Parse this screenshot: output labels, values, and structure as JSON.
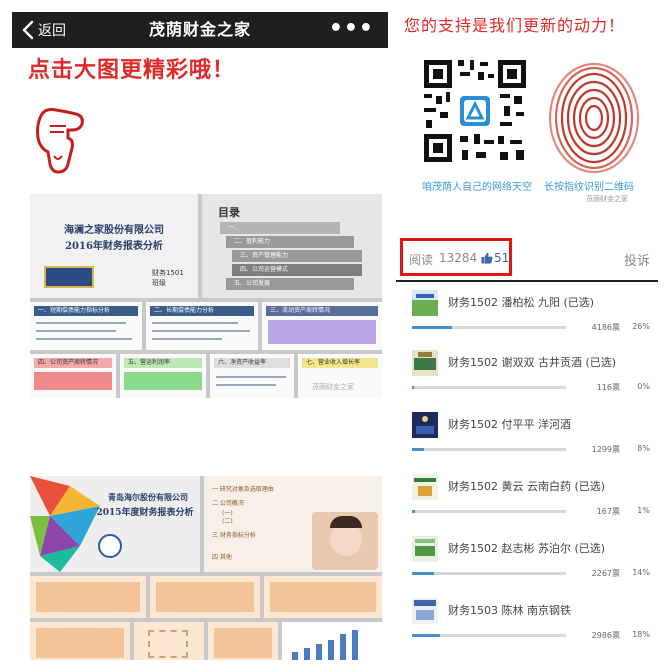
{
  "nav": {
    "back_label": "返回",
    "title": "茂荫财金之家",
    "more": "•••"
  },
  "left": {
    "promo": "点击大图更精彩哦！",
    "slides_1": {
      "company_line1": "海澜之家股份有限公司",
      "company_line2": "2016年财务报表分析",
      "author_line1": "财务1501",
      "author_line2": "班级",
      "toc_title": "目录",
      "toc_items": [
        "一、",
        "二、盈利能力",
        "三、资产管理能力",
        "四、公司运营模式",
        "五、公司发展",
        "六、行业情况"
      ],
      "cards": [
        "一、短期偿债能力指标分析",
        "二、长期偿债能力分析",
        "三、流动资产周转情况",
        "四、公司资产周转情况",
        "五、营运利润率",
        "六、净资产收益率",
        "七、营业收入增长率"
      ],
      "watermark": "茂荫财金之家"
    },
    "slides_2": {
      "company_line1": "青岛海尔股份有限公司",
      "company_line2": "2015年度财务报表分析",
      "toc_items": [
        "一 研究对象及选取理由",
        "二 公司概况",
        "三 财务指标分析",
        "四 其他"
      ],
      "sub_items": [
        "(一)",
        "(二)",
        "(三)"
      ]
    }
  },
  "right": {
    "support": "您的支持是我们更新的动力！",
    "qr_caption_left": "咱茂荫人自己的网络天空",
    "qr_caption_right": "长按指纹识别二维码",
    "qr_watermark": "茂荫财金之家",
    "read_label": "阅读",
    "read_count": "13284",
    "like_count": "51",
    "report": "投诉"
  },
  "votes": [
    {
      "label": "财务1502 潘柏松 九阳 (已选)",
      "count": "4186票",
      "pct": "26%",
      "share": 0.26
    },
    {
      "label": "财务1502 谢双双 古井贡酒 (已选)",
      "count": "116票",
      "pct": "0%",
      "share": 0.0
    },
    {
      "label": "财务1502 付平平 洋河酒",
      "count": "1299票",
      "pct": "8%",
      "share": 0.08
    },
    {
      "label": "财务1502 黄云 云南白药 (已选)",
      "count": "167票",
      "pct": "1%",
      "share": 0.01
    },
    {
      "label": "财务1502 赵志彬 苏泊尔 (已选)",
      "count": "2267票",
      "pct": "14%",
      "share": 0.14
    },
    {
      "label": "财务1503 陈林 南京钢铁",
      "count": "2986票",
      "pct": "18%",
      "share": 0.18
    }
  ],
  "colors": {
    "accent_red": "#e02a2a",
    "nav_bg": "#1f1f1f",
    "progress": "#4a90c8",
    "highlight_box": "#e01515"
  }
}
